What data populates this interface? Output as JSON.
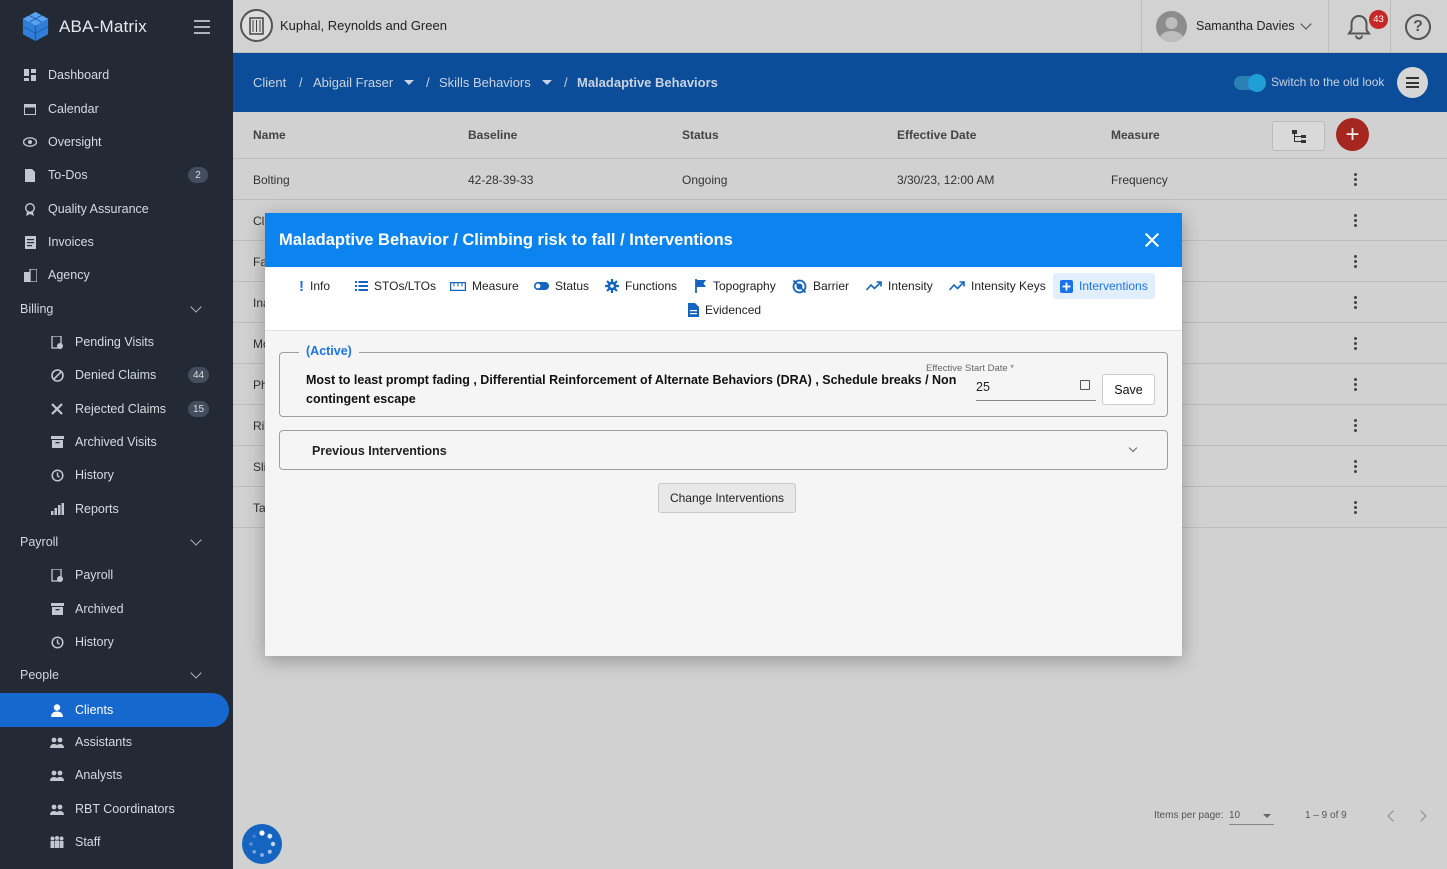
{
  "app": {
    "name": "ABA-Matrix"
  },
  "sidebar": {
    "items": [
      {
        "label": "Dashboard"
      },
      {
        "label": "Calendar"
      },
      {
        "label": "Oversight"
      },
      {
        "label": "To-Dos",
        "badge": "2"
      },
      {
        "label": "Quality Assurance"
      },
      {
        "label": "Invoices"
      },
      {
        "label": "Agency"
      }
    ],
    "billing": {
      "label": "Billing",
      "items": [
        {
          "label": "Pending Visits"
        },
        {
          "label": "Denied Claims",
          "badge": "44"
        },
        {
          "label": "Rejected Claims",
          "badge": "15"
        },
        {
          "label": "Archived Visits"
        },
        {
          "label": "History"
        },
        {
          "label": "Reports"
        }
      ]
    },
    "payroll": {
      "label": "Payroll",
      "items": [
        {
          "label": "Payroll"
        },
        {
          "label": "Archived"
        },
        {
          "label": "History"
        }
      ]
    },
    "people": {
      "label": "People",
      "items": [
        {
          "label": "Clients"
        },
        {
          "label": "Assistants"
        },
        {
          "label": "Analysts"
        },
        {
          "label": "RBT Coordinators"
        },
        {
          "label": "Staff"
        }
      ]
    }
  },
  "header": {
    "agency_name": "Kuphal, Reynolds and Green",
    "user_name": "Samantha Davies",
    "notification_count": "43"
  },
  "breadcrumb": {
    "client": "Client",
    "client_name": "Abigail Fraser",
    "section": "Skills Behaviors",
    "current": "Maladaptive Behaviors",
    "toggle_label": "Switch to the old look"
  },
  "table": {
    "headers": [
      "Name",
      "Baseline",
      "Status",
      "Effective Date",
      "Measure"
    ],
    "rows": [
      {
        "name": "Bolting",
        "baseline": "42-28-39-33",
        "status": "Ongoing",
        "date": "3/30/23, 12:00 AM",
        "measure": "Frequency"
      },
      {
        "name": "Cl"
      },
      {
        "name": "Fa"
      },
      {
        "name": "Ina"
      },
      {
        "name": "Mo"
      },
      {
        "name": "Ph"
      },
      {
        "name": "Rit"
      },
      {
        "name": "Sli"
      },
      {
        "name": "Ta"
      }
    ],
    "paginator": {
      "items_per_page_label": "Items per page:",
      "items_per_page": "10",
      "range": "1 – 9 of 9"
    }
  },
  "modal": {
    "title": "Maladaptive Behavior / Climbing risk to fall / Interventions",
    "tabs": [
      {
        "label": "Info"
      },
      {
        "label": "STOs/LTOs"
      },
      {
        "label": "Measure"
      },
      {
        "label": "Status"
      },
      {
        "label": "Functions"
      },
      {
        "label": "Topography"
      },
      {
        "label": "Barrier"
      },
      {
        "label": "Intensity"
      },
      {
        "label": "Intensity Keys"
      },
      {
        "label": "Interventions"
      },
      {
        "label": "Evidenced"
      }
    ],
    "active_tab": "Interventions",
    "active_legend": "(Active)",
    "active_interventions": "Most to least prompt fading , Differential Reinforcement of Alternate Behaviors (DRA) , Schedule breaks / Non contingent escape",
    "date_label": "Effective Start Date *",
    "date_value": "25",
    "save_label": "Save",
    "previous_label": "Previous Interventions",
    "change_label": "Change Interventions"
  },
  "colors": {
    "sidebar_bg": "#232a36",
    "active_nav": "#1668cf",
    "modal_header": "#0b84f0",
    "breadcrumb_bg": "#0b4d98",
    "badge_red": "#c62828"
  }
}
